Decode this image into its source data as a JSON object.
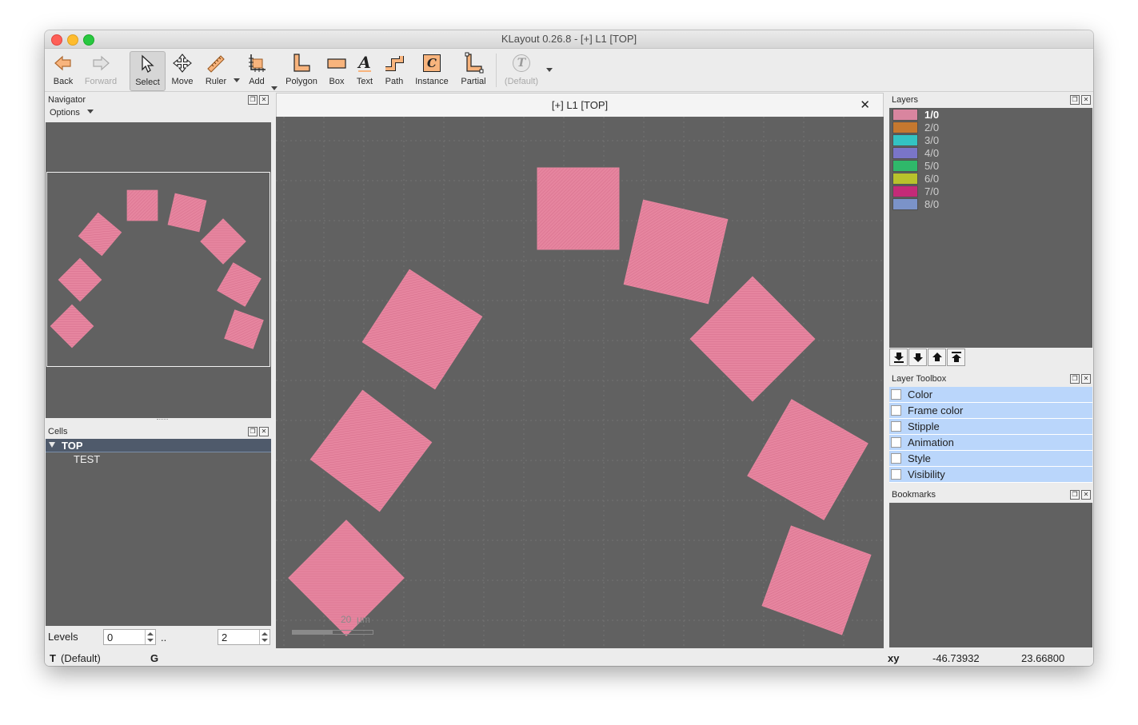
{
  "window": {
    "title": "KLayout 0.26.8 - [+] L1 [TOP]",
    "traffic_colors": [
      "#fe5f57",
      "#febc2e",
      "#28c840"
    ]
  },
  "toolbar": {
    "back": "Back",
    "forward": "Forward",
    "select": "Select",
    "move": "Move",
    "ruler": "Ruler",
    "add": "Add",
    "polygon": "Polygon",
    "box": "Box",
    "text": "Text",
    "path": "Path",
    "instance": "Instance",
    "partial": "Partial",
    "default": "(Default)",
    "text_icon_glyph": "A",
    "instance_icon_glyph": "C",
    "default_icon_glyph": "T",
    "accent": "#f5a25d"
  },
  "navigator": {
    "title": "Navigator",
    "options": "Options"
  },
  "cells": {
    "title": "Cells",
    "tree": [
      {
        "name": "TOP",
        "expanded": true,
        "selected": true
      },
      {
        "name": "TEST",
        "expanded": false,
        "selected": false
      }
    ],
    "levels_label": "Levels",
    "levels_from": "0",
    "levels_sep": "..",
    "levels_to": "2"
  },
  "layout_tab": {
    "title": "[+] L1 [TOP]",
    "close_glyph": "✕",
    "scale_label": "20  μm",
    "shape_color": "#e6859f",
    "canvas_color": "#616161"
  },
  "layers": {
    "title": "Layers",
    "items": [
      {
        "name": "1/0",
        "color": "#d9859f",
        "selected": true
      },
      {
        "name": "2/0",
        "color": "#c5782f",
        "selected": false
      },
      {
        "name": "3/0",
        "color": "#33c3c3",
        "selected": false
      },
      {
        "name": "4/0",
        "color": "#7a75c8",
        "selected": false
      },
      {
        "name": "5/0",
        "color": "#2fb86a",
        "selected": false
      },
      {
        "name": "6/0",
        "color": "#b8c22c",
        "selected": false
      },
      {
        "name": "7/0",
        "color": "#c42a78",
        "selected": false
      },
      {
        "name": "8/0",
        "color": "#7b93c9",
        "selected": false
      }
    ]
  },
  "layer_toolbox": {
    "title": "Layer Toolbox",
    "items": [
      "Color",
      "Frame color",
      "Stipple",
      "Animation",
      "Style",
      "Visibility"
    ]
  },
  "bookmarks": {
    "title": "Bookmarks"
  },
  "statusbar": {
    "mode": "T",
    "mode_value": "(Default)",
    "grid_flag": "G",
    "coord_label": "xy",
    "x": "-46.73932",
    "y": "23.66800"
  }
}
